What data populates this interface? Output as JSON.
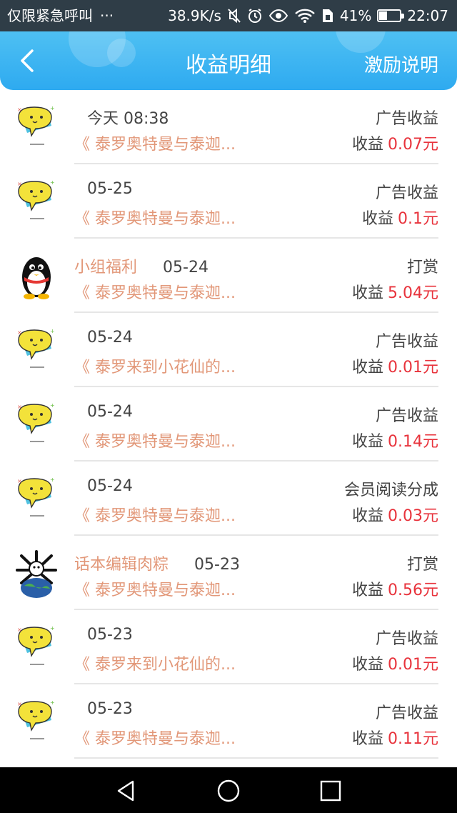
{
  "status_bar": {
    "carrier_text": "仅限紧急呼叫",
    "more_dots": "···",
    "speed": "38.9K/s",
    "battery_text": "41%",
    "battery_level": 0.41,
    "time": "22:07",
    "icons": [
      "mute-icon",
      "alarm-icon",
      "eye-icon",
      "wifi-icon",
      "sim-icon",
      "battery-icon"
    ]
  },
  "header": {
    "title": "收益明细",
    "right_link": "激励说明",
    "colors": {
      "bar_top": "#4ec0f3",
      "bar_bottom": "#2eaaf0"
    }
  },
  "colors": {
    "username": "#e29778",
    "book": "#e29778",
    "amount": "#e8333c",
    "text": "#444444"
  },
  "income_prefix": "收益",
  "records": [
    {
      "avatar": "chat-bubble-avatar",
      "user": "",
      "date": "今天 08:38",
      "book": "《 泰罗奥特曼与泰迦...",
      "type": "广告收益",
      "amount": "0.07元"
    },
    {
      "avatar": "chat-bubble-avatar",
      "user": "",
      "date": "05-25",
      "book": "《 泰罗奥特曼与泰迦...",
      "type": "广告收益",
      "amount": "0.1元"
    },
    {
      "avatar": "penguin-avatar",
      "user": "小组福利",
      "date": "05-24",
      "book": "《 泰罗奥特曼与泰迦...",
      "type": "打赏",
      "amount": "5.04元"
    },
    {
      "avatar": "chat-bubble-avatar",
      "user": "",
      "date": "05-24",
      "book": "《 泰罗来到小花仙的...",
      "type": "广告收益",
      "amount": "0.01元"
    },
    {
      "avatar": "chat-bubble-avatar",
      "user": "",
      "date": "05-24",
      "book": "《 泰罗奥特曼与泰迦...",
      "type": "广告收益",
      "amount": "0.14元"
    },
    {
      "avatar": "chat-bubble-avatar",
      "user": "",
      "date": "05-24",
      "book": "《 泰罗奥特曼与泰迦...",
      "type": "会员阅读分成",
      "amount": "0.03元"
    },
    {
      "avatar": "globe-avatar",
      "user": "话本编辑肉粽",
      "date": "05-23",
      "book": "《 泰罗奥特曼与泰迦...",
      "type": "打赏",
      "amount": "0.56元"
    },
    {
      "avatar": "chat-bubble-avatar",
      "user": "",
      "date": "05-23",
      "book": "《 泰罗来到小花仙的...",
      "type": "广告收益",
      "amount": "0.01元"
    },
    {
      "avatar": "chat-bubble-avatar",
      "user": "",
      "date": "05-23",
      "book": "《 泰罗奥特曼与泰迦...",
      "type": "广告收益",
      "amount": "0.11元"
    }
  ],
  "nav_bar": {
    "buttons": [
      "back-triangle-icon",
      "home-circle-icon",
      "recents-square-icon"
    ]
  }
}
